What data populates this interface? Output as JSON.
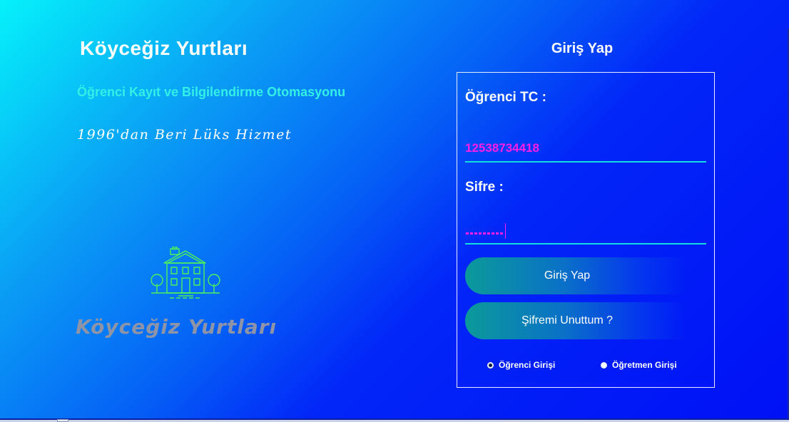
{
  "branding": {
    "title": "Köyceğiz Yurtları",
    "subtitle": "Öğrenci Kayıt ve Bilgilendirme Otomasyonu",
    "tagline": "1996'dan Beri Lüks Hizmet",
    "logo_text": "Köyceğiz Yurtları",
    "icon": "house-icon"
  },
  "login": {
    "heading": "Giriş Yap",
    "tc_label": "Öğrenci TC :",
    "tc_value": "12538734418",
    "password_label": "Sifre :",
    "password_masked_length": 9,
    "login_button": "Giriş Yap",
    "forgot_button": "Şifremi Unuttum ?",
    "radios": [
      {
        "label": "Öğrenci Girişi",
        "checked": true
      },
      {
        "label": "Öğretmen Girişi",
        "checked": false
      }
    ]
  },
  "colors": {
    "accent_cyan": "#13dede",
    "input_text": "#ff1ee6",
    "subtitle": "#32f0e6",
    "icon_green": "#4cf25a"
  }
}
